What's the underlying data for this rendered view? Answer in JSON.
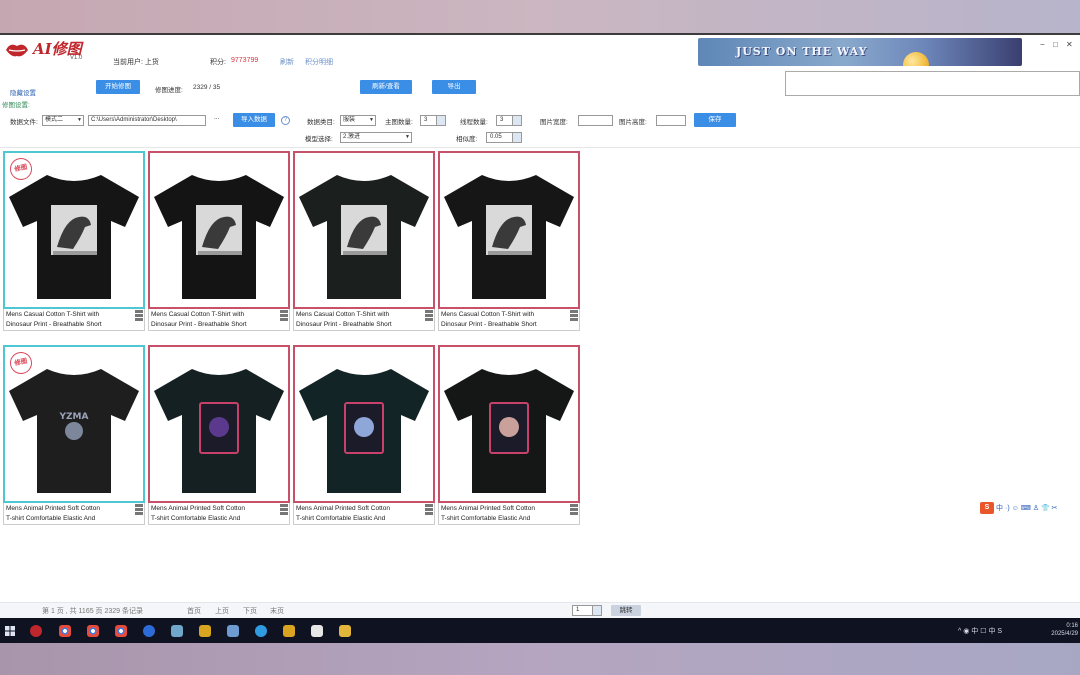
{
  "app": {
    "title": "AI修图",
    "version": "V1.0",
    "user_label": "当前用户: 上货",
    "points_label": "积分:",
    "points_value": "9773799",
    "recharge_link": "刷新",
    "points_detail_link": "积分明细",
    "banner_text": "JUST ON THE WAY",
    "win_min": "−",
    "win_max": "□",
    "win_close": "✕"
  },
  "toolbar": {
    "hide_settings": "隐藏设置",
    "start_button": "开始修图",
    "progress_label": "修图进度:",
    "progress_value": "2329 / 35",
    "refresh_button": "刷新/查看",
    "export_button": "导出",
    "settings_section": "修图设置:"
  },
  "settings": {
    "data_file_label": "数据文件:",
    "mode_select": "模式二",
    "path_value": "C:\\Users\\Administrator\\Desktop\\",
    "browse": "...",
    "import_button": "导入数据",
    "help": "?",
    "data_type_label": "数据类目:",
    "data_type_value": "服装",
    "main_count_label": "主图数量:",
    "main_count_value": "3",
    "thread_count_label": "线程数量:",
    "thread_count_value": "3",
    "img_width_label": "图片宽度:",
    "img_height_label": "图片高度:",
    "save_button": "保存",
    "model_label": "模型选择:",
    "model_value": "2.激进",
    "similarity_label": "相似度:",
    "similarity_value": "0.05"
  },
  "cards": [
    {
      "stamp": "修图",
      "line1": "Mens Casual Cotton T-Shirt with",
      "line2": "Dinosaur Print - Breathable Short"
    },
    {
      "stamp": "",
      "line1": "Mens Casual Cotton T-Shirt with",
      "line2": "Dinosaur Print - Breathable Short"
    },
    {
      "stamp": "",
      "line1": "Mens Casual Cotton T-Shirt with",
      "line2": "Dinosaur Print - Breathable Short"
    },
    {
      "stamp": "",
      "line1": "Mens Casual Cotton T-Shirt with",
      "line2": "Dinosaur Print - Breathable Short"
    },
    {
      "stamp": "修图",
      "line1": "Mens Animal Printed Soft Cotton",
      "line2": "T-shirt Comfortable Elastic And"
    },
    {
      "stamp": "",
      "line1": "Mens Animal Printed Soft Cotton",
      "line2": "T-shirt Comfortable Elastic And"
    },
    {
      "stamp": "",
      "line1": "Mens Animal Printed Soft Cotton",
      "line2": "T-shirt Comfortable Elastic And"
    },
    {
      "stamp": "",
      "line1": "Mens Animal Printed Soft Cotton",
      "line2": "T-shirt Comfortable Elastic And"
    }
  ],
  "pager": {
    "summary": "第 1 页 , 共 1165 页 2329 条记录",
    "first": "首页",
    "prev": "上页",
    "next": "下页",
    "last": "末页",
    "page_input": "1",
    "jump_button": "跳转"
  },
  "ime": {
    "logo": "S",
    "lang": "中",
    "items": "·) ☺ ⌨ ♙ 👕 ✂"
  },
  "taskbar": {
    "tray": "^ ◉ 中 ☐ 中 S",
    "time": "0:16",
    "date": "2025/4/29"
  },
  "colors": {
    "accent_blue": "#3a8ee6",
    "selected_border": "#4fc7d3",
    "card_border": "#c8516a",
    "points_red": "#d9363e"
  }
}
